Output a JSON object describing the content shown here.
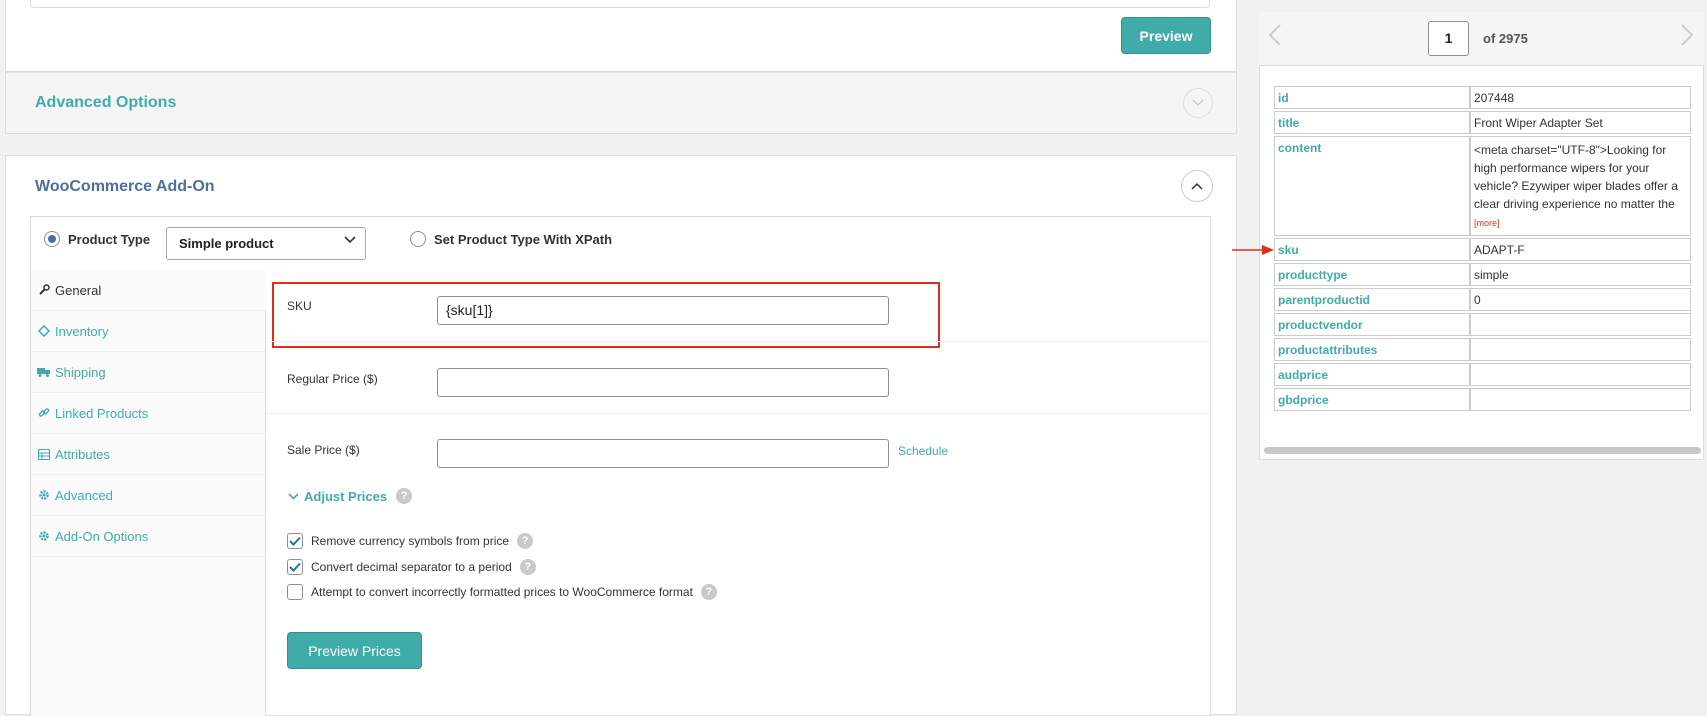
{
  "top": {
    "preview_label": "Preview"
  },
  "advanced": {
    "title": "Advanced Options"
  },
  "woo": {
    "title": "WooCommerce Add-On",
    "product_type_label": "Product Type",
    "product_type_value": "Simple product",
    "xpath_label": "Set Product Type With XPath",
    "tabs": [
      {
        "label": "General",
        "icon": "wrench-icon"
      },
      {
        "label": "Inventory",
        "icon": "tag-icon"
      },
      {
        "label": "Shipping",
        "icon": "truck-icon"
      },
      {
        "label": "Linked Products",
        "icon": "link-icon"
      },
      {
        "label": "Attributes",
        "icon": "table-icon"
      },
      {
        "label": "Advanced",
        "icon": "gear-icon"
      },
      {
        "label": "Add-On Options",
        "icon": "gear-icon"
      }
    ],
    "sku_label": "SKU",
    "sku_value": "{sku[1]}",
    "regular_price_label": "Regular Price ($)",
    "regular_price_value": "",
    "sale_price_label": "Sale Price ($)",
    "sale_price_value": "",
    "schedule_label": "Schedule",
    "adjust_prices_label": "Adjust Prices",
    "options": [
      {
        "label": "Remove currency symbols from price",
        "checked": true
      },
      {
        "label": "Convert decimal separator to a period",
        "checked": true
      },
      {
        "label": "Attempt to convert incorrectly formatted prices to WooCommerce format",
        "checked": false
      }
    ],
    "preview_prices_label": "Preview Prices"
  },
  "record": {
    "page": "1",
    "of_label": "of 2975",
    "rows": [
      {
        "key": "id",
        "value": "207448"
      },
      {
        "key": "title",
        "value": "Front Wiper Adapter Set"
      },
      {
        "key": "content",
        "value": "<meta charset=\"UTF-8\">Looking for high performance wipers for your vehicle? Ezywiper wiper blades offer a clear driving experience no matter the",
        "more": "[more]"
      },
      {
        "key": "sku",
        "value": "ADAPT-F"
      },
      {
        "key": "producttype",
        "value": "simple"
      },
      {
        "key": "parentproductid",
        "value": "0"
      },
      {
        "key": "productvendor",
        "value": ""
      },
      {
        "key": "productattributes",
        "value": ""
      },
      {
        "key": "audprice",
        "value": ""
      },
      {
        "key": "gbdprice",
        "value": ""
      }
    ]
  },
  "colors": {
    "accent": "#40aca9",
    "title_blue": "#4d6f9e",
    "highlight_red": "#e02c1f"
  }
}
